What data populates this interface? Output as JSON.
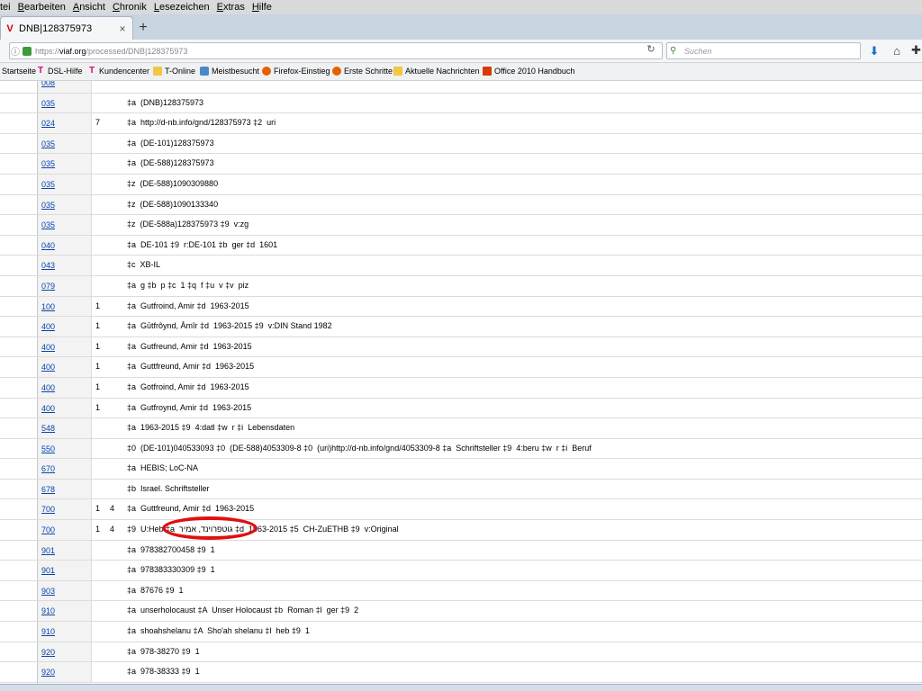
{
  "menubar": {
    "items": [
      {
        "pre": "",
        "acc": "",
        "post": "tei"
      },
      {
        "pre": "",
        "acc": "B",
        "post": "earbeiten"
      },
      {
        "pre": "",
        "acc": "A",
        "post": "nsicht"
      },
      {
        "pre": "",
        "acc": "C",
        "post": "hronik"
      },
      {
        "pre": "",
        "acc": "L",
        "post": "esezeichen"
      },
      {
        "pre": "",
        "acc": "E",
        "post": "xtras"
      },
      {
        "pre": "",
        "acc": "H",
        "post": "ilfe"
      }
    ]
  },
  "tab": {
    "label": "DNB|128375973",
    "close": "×",
    "new_tab": "+"
  },
  "navbar": {
    "url_scheme": "https://",
    "url_domain": "viaf.org",
    "url_path": "/processed/DNB|128375973",
    "search_placeholder": "Suchen"
  },
  "bookmarks": [
    {
      "label": "Startseite",
      "icon": "none"
    },
    {
      "label": "DSL-Hilfe",
      "icon": "telekom"
    },
    {
      "label": "Kundencenter",
      "icon": "telekom"
    },
    {
      "label": "T-Online",
      "icon": "folder"
    },
    {
      "label": "Meistbesucht",
      "icon": "globe"
    },
    {
      "label": "Firefox-Einstieg",
      "icon": "firefox"
    },
    {
      "label": "Erste Schritte",
      "icon": "firefox"
    },
    {
      "label": "Aktuelle Nachrichten",
      "icon": "folder"
    },
    {
      "label": "Office 2010 Handbuch",
      "icon": "office"
    }
  ],
  "records": [
    {
      "tag": "008",
      "ind1": "",
      "ind2": "",
      "content": ""
    },
    {
      "tag": "035",
      "ind1": "",
      "ind2": "",
      "content": "‡a  (DNB)128375973"
    },
    {
      "tag": "024",
      "ind1": "7",
      "ind2": "",
      "content": "‡a  http://d-nb.info/gnd/128375973 ‡2  uri"
    },
    {
      "tag": "035",
      "ind1": "",
      "ind2": "",
      "content": "‡a  (DE-101)128375973"
    },
    {
      "tag": "035",
      "ind1": "",
      "ind2": "",
      "content": "‡a  (DE-588)128375973"
    },
    {
      "tag": "035",
      "ind1": "",
      "ind2": "",
      "content": "‡z  (DE-588)1090309880"
    },
    {
      "tag": "035",
      "ind1": "",
      "ind2": "",
      "content": "‡z  (DE-588)1090133340"
    },
    {
      "tag": "035",
      "ind1": "",
      "ind2": "",
      "content": "‡z  (DE-588a)128375973 ‡9  v:zg"
    },
    {
      "tag": "040",
      "ind1": "",
      "ind2": "",
      "content": "‡a  DE-101 ‡9  r:DE-101 ‡b  ger ‡d  1601"
    },
    {
      "tag": "043",
      "ind1": "",
      "ind2": "",
      "content": "‡c  XB-IL"
    },
    {
      "tag": "079",
      "ind1": "",
      "ind2": "",
      "content": "‡a  g ‡b  p ‡c  1 ‡q  f ‡u  v ‡v  piz"
    },
    {
      "tag": "100",
      "ind1": "1",
      "ind2": "",
      "content": "‡a  Gutfroind, Amir ‡d  1963-2015"
    },
    {
      "tag": "400",
      "ind1": "1",
      "ind2": "",
      "content": "‡a  Gūtfrôynd, Āmîr ‡d  1963-2015 ‡9  v:DIN Stand 1982"
    },
    {
      "tag": "400",
      "ind1": "1",
      "ind2": "",
      "content": "‡a  Gutfreund, Amir ‡d  1963-2015"
    },
    {
      "tag": "400",
      "ind1": "1",
      "ind2": "",
      "content": "‡a  Guttfreund, Amir ‡d  1963-2015"
    },
    {
      "tag": "400",
      "ind1": "1",
      "ind2": "",
      "content": "‡a  Gotfroind, Amir ‡d  1963-2015"
    },
    {
      "tag": "400",
      "ind1": "1",
      "ind2": "",
      "content": "‡a  Gutfroynd, Amir ‡d  1963-2015"
    },
    {
      "tag": "548",
      "ind1": "",
      "ind2": "",
      "content": "‡a  1963-2015 ‡9  4:datl ‡w  r ‡i  Lebensdaten"
    },
    {
      "tag": "550",
      "ind1": "",
      "ind2": "",
      "content": "‡0  (DE-101)040533093 ‡0  (DE-588)4053309-8 ‡0  (uri)http://d-nb.info/gnd/4053309-8 ‡a  Schriftsteller ‡9  4:beru ‡w  r ‡i  Beruf"
    },
    {
      "tag": "670",
      "ind1": "",
      "ind2": "",
      "content": "‡a  HEBIS; LoC-NA"
    },
    {
      "tag": "678",
      "ind1": "",
      "ind2": "",
      "content": "‡b  Israel. Schriftsteller"
    },
    {
      "tag": "700",
      "ind1": "1",
      "ind2": "4",
      "content": "‡a  Guttfreund, Amir ‡d  1963-2015"
    },
    {
      "tag": "700",
      "ind1": "1",
      "ind2": "4",
      "content": "‡9  U:Heb ‡a  גוטפרוינד, אמיר ‡d  1963-2015 ‡5  CH-ZuETHB ‡9  v:Original"
    },
    {
      "tag": "901",
      "ind1": "",
      "ind2": "",
      "content": "‡a  978382700458 ‡9  1"
    },
    {
      "tag": "901",
      "ind1": "",
      "ind2": "",
      "content": "‡a  978383330309 ‡9  1"
    },
    {
      "tag": "903",
      "ind1": "",
      "ind2": "",
      "content": "‡a  87676 ‡9  1"
    },
    {
      "tag": "910",
      "ind1": "",
      "ind2": "",
      "content": "‡a  unserholocaust ‡A  Unser Holocaust ‡b  Roman ‡l  ger ‡9  2"
    },
    {
      "tag": "910",
      "ind1": "",
      "ind2": "",
      "content": "‡a  shoahshelanu ‡A  Sho'ah shelanu ‡l  heb ‡9  1"
    },
    {
      "tag": "920",
      "ind1": "",
      "ind2": "",
      "content": "‡a  978-38270 ‡9  1"
    },
    {
      "tag": "920",
      "ind1": "",
      "ind2": "",
      "content": "‡a  978-38333 ‡9  1"
    }
  ]
}
